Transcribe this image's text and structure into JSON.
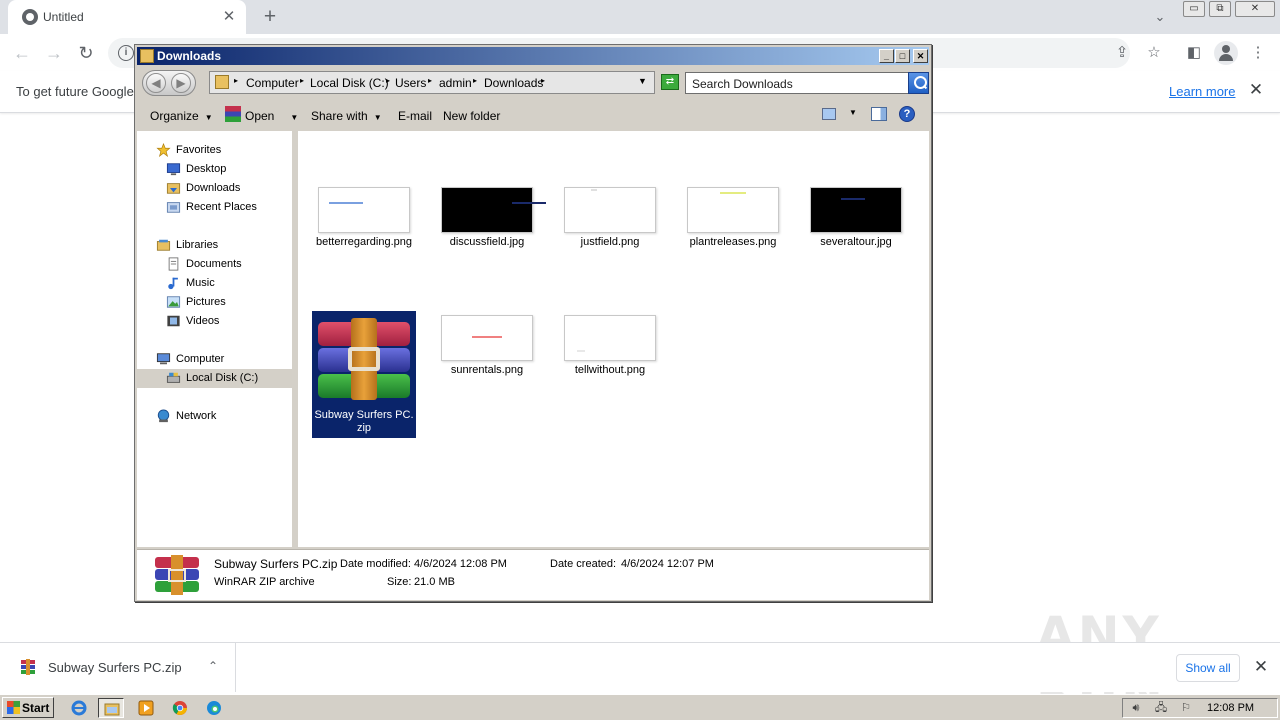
{
  "chrome": {
    "tab_title": "Untitled",
    "infobar_text": "To get future Google",
    "infobar_link": "Learn more"
  },
  "download_shelf": {
    "file_name": "Subway Surfers PC.zip",
    "show_all_label": "Show all"
  },
  "watermark": "ANY RUN",
  "explorer": {
    "title": "Downloads",
    "breadcrumbs": [
      "Computer",
      "Local Disk (C:)",
      "Users",
      "admin",
      "Downloads"
    ],
    "search_placeholder": "Search Downloads",
    "commands": {
      "organize": "Organize",
      "open": "Open",
      "share_with": "Share with",
      "email": "E-mail",
      "new_folder": "New folder"
    },
    "nav": {
      "favorites": "Favorites",
      "desktop": "Desktop",
      "downloads": "Downloads",
      "recent_places": "Recent Places",
      "libraries": "Libraries",
      "documents": "Documents",
      "music": "Music",
      "pictures": "Pictures",
      "videos": "Videos",
      "computer": "Computer",
      "local_disk": "Local Disk (C:)",
      "network": "Network"
    },
    "files": [
      {
        "name": "betterregarding.png",
        "thumb_bg": "#ffffff",
        "accent": "#7aa0e0"
      },
      {
        "name": "discussfield.jpg",
        "thumb_bg": "#000000",
        "accent": "#1a2a6a"
      },
      {
        "name": "justfield.png",
        "thumb_bg": "#ffffff",
        "accent": "#e0e0e0"
      },
      {
        "name": "plantreleases.png",
        "thumb_bg": "#ffffff",
        "accent": "#e4ec80"
      },
      {
        "name": "severaltour.jpg",
        "thumb_bg": "#000000",
        "accent": "#1a2a6a"
      },
      {
        "name": "Subway Surfers PC.zip",
        "selected": true
      },
      {
        "name": "sunrentals.png",
        "thumb_bg": "#ffffff",
        "accent": "#f08080"
      },
      {
        "name": "tellwithout.png",
        "thumb_bg": "#ffffff",
        "accent": "#e8e8e8"
      }
    ],
    "details": {
      "file_name": "Subway Surfers PC.zip",
      "file_type": "WinRAR ZIP archive",
      "date_modified_label": "Date modified:",
      "date_modified": "4/6/2024 12:08 PM",
      "date_created_label": "Date created:",
      "date_created": "4/6/2024 12:07 PM",
      "size_label": "Size:",
      "size": "21.0 MB"
    }
  },
  "taskbar": {
    "start_label": "Start",
    "clock": "12:08 PM"
  }
}
